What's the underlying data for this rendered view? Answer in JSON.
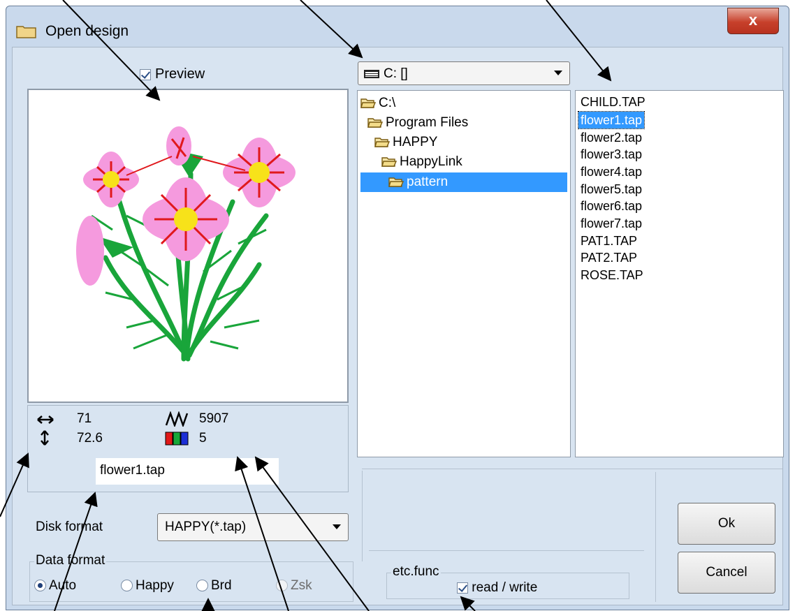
{
  "window": {
    "title": "Open design",
    "close_label": "x"
  },
  "preview": {
    "checkbox_label": "Preview",
    "checked": true
  },
  "info": {
    "width_value": "71",
    "height_value": "72.6",
    "stitches_value": "5907",
    "colors_value": "5",
    "filename": "flower1.tap"
  },
  "disk_format": {
    "label": "Disk format",
    "selected": "HAPPY(*.tap)"
  },
  "data_format": {
    "group_title": "Data format",
    "options": [
      "Auto",
      "Happy",
      "Brd",
      "Zsk"
    ],
    "selected": "Auto"
  },
  "drive": {
    "selected": "C: []"
  },
  "tree": {
    "items": [
      "C:\\",
      "Program Files",
      "HAPPY",
      "HappyLink",
      "pattern"
    ],
    "selected": "pattern"
  },
  "files": {
    "items": [
      "CHILD.TAP",
      "flower1.tap",
      "flower2.tap",
      "flower3.tap",
      "flower4.tap",
      "flower5.tap",
      "flower6.tap",
      "flower7.tap",
      "PAT1.TAP",
      "PAT2.TAP",
      "ROSE.TAP"
    ],
    "selected": "flower1.tap"
  },
  "etc": {
    "group_title": "etc.func",
    "checkbox_label": "read / write",
    "checked": true
  },
  "buttons": {
    "ok": "Ok",
    "cancel": "Cancel"
  },
  "colors": {
    "selection": "#3399ff",
    "window_bg": "#d8e4f1",
    "close_red": "#c7402b"
  }
}
